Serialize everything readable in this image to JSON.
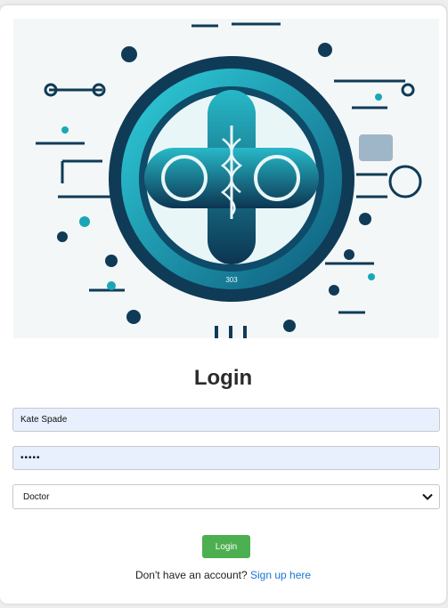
{
  "hero": {
    "badge_text": "303"
  },
  "login": {
    "title": "Login",
    "username_value": "Kate Spade",
    "password_value": "•••••",
    "role_selected": "Doctor",
    "submit_label": "Login",
    "signup_prompt": "Don't have an account?",
    "signup_link": "Sign up here"
  },
  "colors": {
    "accent_teal": "#1aa6b7",
    "dark_navy": "#0f3b57",
    "button_green": "#4caf50",
    "link_blue": "#1976d2",
    "autofill_blue": "#e8f0fe"
  }
}
